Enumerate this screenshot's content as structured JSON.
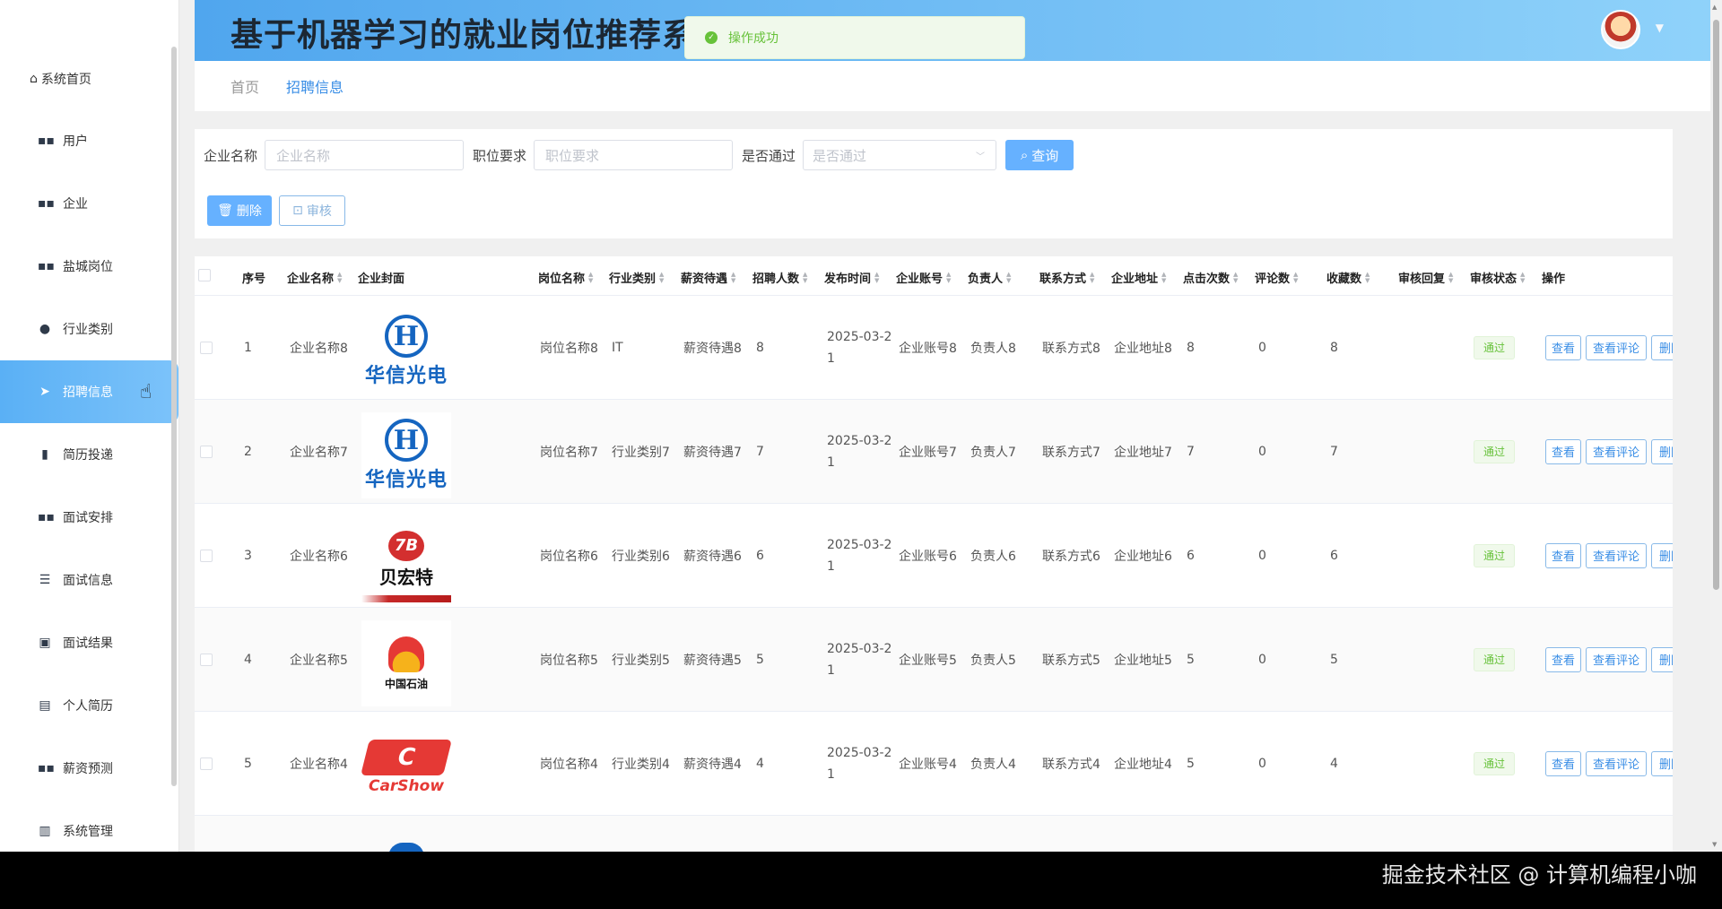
{
  "app": {
    "title": "基于机器学习的就业岗位推荐系统"
  },
  "toast": {
    "message": "操作成功"
  },
  "sidebar": {
    "home": "系统首页",
    "items": [
      {
        "label": "用户",
        "icon": "grid-icon"
      },
      {
        "label": "企业",
        "icon": "grid-icon"
      },
      {
        "label": "盐城岗位",
        "icon": "grid-icon"
      },
      {
        "label": "行业类别",
        "icon": "bulb-icon"
      },
      {
        "label": "招聘信息",
        "icon": "send-icon",
        "active": true
      },
      {
        "label": "简历投递",
        "icon": "bar-chart-icon"
      },
      {
        "label": "面试安排",
        "icon": "grid-icon"
      },
      {
        "label": "面试信息",
        "icon": "sliders-icon"
      },
      {
        "label": "面试结果",
        "icon": "line-chart-icon"
      },
      {
        "label": "个人简历",
        "icon": "clipboard-icon"
      },
      {
        "label": "薪资预测",
        "icon": "grid-icon"
      },
      {
        "label": "系统管理",
        "icon": "book-icon"
      }
    ]
  },
  "breadcrumb": {
    "home": "首页",
    "current": "招聘信息"
  },
  "search": {
    "company_label": "企业名称",
    "company_placeholder": "企业名称",
    "job_label": "职位要求",
    "job_placeholder": "职位要求",
    "pass_label": "是否通过",
    "pass_placeholder": "是否通过",
    "query_button": "查询",
    "delete_button": "删除",
    "audit_button": "审核"
  },
  "table": {
    "headers": [
      "序号",
      "企业名称",
      "企业封面",
      "岗位名称",
      "行业类别",
      "薪资待遇",
      "招聘人数",
      "发布时间",
      "企业账号",
      "负责人",
      "联系方式",
      "企业地址",
      "点击次数",
      "评论数",
      "收藏数",
      "审核回复",
      "审核状态",
      "操作"
    ],
    "rows": [
      {
        "index": "1",
        "company": "企业名称8",
        "logo": "huaxin",
        "job": "岗位名称8",
        "industry": "IT",
        "salary": "薪资待遇8",
        "count": "8",
        "date_a": "2025-03-2",
        "date_b": "1",
        "account": "企业账号8",
        "manager": "负责人8",
        "contact": "联系方式8",
        "address": "企业地址8",
        "clicks": "8",
        "comments": "0",
        "favorites": "8",
        "status": "通过"
      },
      {
        "index": "2",
        "company": "企业名称7",
        "logo": "huaxin",
        "job": "岗位名称7",
        "industry": "行业类别7",
        "salary": "薪资待遇7",
        "count": "7",
        "date_a": "2025-03-2",
        "date_b": "1",
        "account": "企业账号7",
        "manager": "负责人7",
        "contact": "联系方式7",
        "address": "企业地址7",
        "clicks": "7",
        "comments": "0",
        "favorites": "7",
        "status": "通过"
      },
      {
        "index": "3",
        "company": "企业名称6",
        "logo": "beihongte",
        "job": "岗位名称6",
        "industry": "行业类别6",
        "salary": "薪资待遇6",
        "count": "6",
        "date_a": "2025-03-2",
        "date_b": "1",
        "account": "企业账号6",
        "manager": "负责人6",
        "contact": "联系方式6",
        "address": "企业地址6",
        "clicks": "6",
        "comments": "0",
        "favorites": "6",
        "status": "通过"
      },
      {
        "index": "4",
        "company": "企业名称5",
        "logo": "petrochina",
        "job": "岗位名称5",
        "industry": "行业类别5",
        "salary": "薪资待遇5",
        "count": "5",
        "date_a": "2025-03-2",
        "date_b": "1",
        "account": "企业账号5",
        "manager": "负责人5",
        "contact": "联系方式5",
        "address": "企业地址5",
        "clicks": "5",
        "comments": "0",
        "favorites": "5",
        "status": "通过"
      },
      {
        "index": "5",
        "company": "企业名称4",
        "logo": "carshow",
        "job": "岗位名称4",
        "industry": "行业类别4",
        "salary": "薪资待遇4",
        "count": "4",
        "date_a": "2025-03-2",
        "date_b": "1",
        "account": "企业账号4",
        "manager": "负责人4",
        "contact": "联系方式4",
        "address": "企业地址4",
        "clicks": "5",
        "comments": "0",
        "favorites": "4",
        "status": "通过"
      }
    ],
    "op_view": "查看",
    "op_view_comments": "查看评论",
    "op_delete": "删除"
  },
  "logos": {
    "huaxin_letter": "H",
    "huaxin_text": "华信光电",
    "beihongte_letter": "7B",
    "beihongte_text": "贝宏特",
    "petrochina_text": "中国石油",
    "carshow_mark": "C",
    "carshow_text": "CarShow"
  },
  "watermark": "掘金技术社区 @ 计算机编程小咖",
  "colors": {
    "accent": "#3a8ee6",
    "active_nav": "#5ab0f5",
    "success": "#67c23a"
  }
}
